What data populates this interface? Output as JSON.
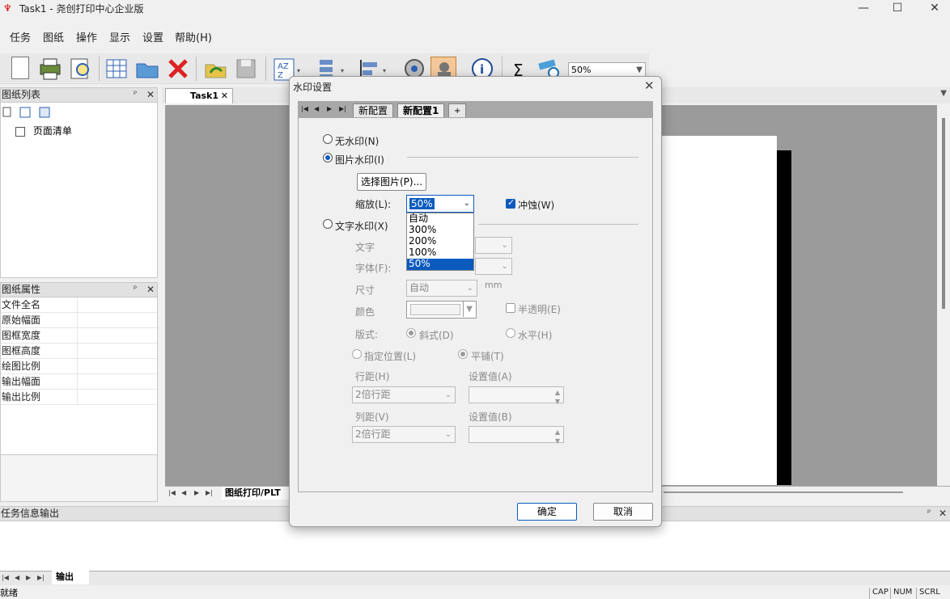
{
  "app": {
    "title": "Task1 - 尧创打印中心企业版",
    "icon": "app-logo-icon",
    "window_buttons": [
      "—",
      "☐",
      "✕"
    ]
  },
  "menu": [
    "任务",
    "图纸",
    "操作",
    "显示",
    "设置",
    "帮助(H)"
  ],
  "toolbar": {
    "zoom": "50%"
  },
  "panels": {
    "list_title": "图纸列表",
    "tree_item": "页面清单",
    "props_title": "图纸属性",
    "props": [
      "文件全名",
      "原始幅面",
      "图框宽度",
      "图框高度",
      "绘图比例",
      "输出幅面",
      "输出比例"
    ],
    "output_title": "任务信息输出",
    "output_tab": "输出"
  },
  "document": {
    "tab": "Task1",
    "sheet_tab": "图纸打印/PLT"
  },
  "status": {
    "text": "就绪",
    "indicators": [
      "CAP",
      "NUM",
      "SCRL"
    ]
  },
  "dialog": {
    "title": "水印设置",
    "tabs": [
      "新配置",
      "新配置1",
      "+"
    ],
    "no_watermark": "无水印(N)",
    "image_watermark": "图片水印(I)",
    "select_image": "选择图片(P)...",
    "scale_label": "缩放(L):",
    "scale_value": "50%",
    "scale_options": [
      "自动",
      "300%",
      "200%",
      "100%",
      "50%"
    ],
    "erode_label": "冲蚀(W)",
    "text_watermark": "文字水印(X)",
    "text_label": "文字",
    "font_label": "字体(F):",
    "size_label": "尺寸",
    "size_value": "自动",
    "size_unit": "mm",
    "color_label": "颜色",
    "translucent_label": "半透明(E)",
    "layout_label": "版式:",
    "diagonal_label": "斜式(D)",
    "horizontal_label": "水平(H)",
    "position_label": "指定位置(L)",
    "tile_label": "平铺(T)",
    "row_spacing_label": "行距(H)",
    "row_spacing_value": "2倍行距",
    "set_value_a_label": "设置值(A)",
    "col_spacing_label": "列距(V)",
    "col_spacing_value": "2倍行距",
    "set_value_b_label": "设置值(B)",
    "ok": "确定",
    "cancel": "取消"
  }
}
